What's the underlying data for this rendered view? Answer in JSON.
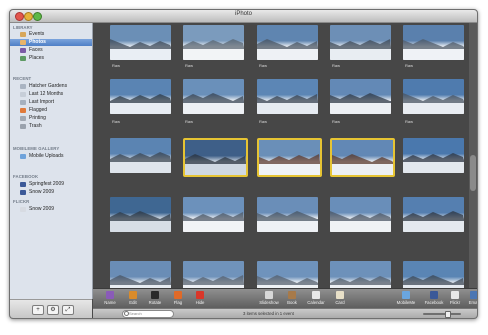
{
  "window": {
    "title": "iPhoto"
  },
  "sidebar": {
    "sections": [
      {
        "name": "library",
        "label": "LIBRARY",
        "items": [
          {
            "label": "Events",
            "icon": "events-icon",
            "color": "#d8a75a"
          },
          {
            "label": "Photos",
            "icon": "photos-icon",
            "color": "#e8b46a",
            "selected": true
          },
          {
            "label": "Faces",
            "icon": "faces-icon",
            "color": "#7b5aa6"
          },
          {
            "label": "Places",
            "icon": "places-icon",
            "color": "#5d9a63"
          }
        ]
      },
      {
        "name": "recent",
        "label": "RECENT",
        "items": [
          {
            "label": "Hatcher Gardens",
            "icon": "event-icon",
            "color": "#aab4c2"
          },
          {
            "label": "Last 12 Months",
            "icon": "calendar-icon",
            "color": "#c7ced8"
          },
          {
            "label": "Last Import",
            "icon": "import-icon",
            "color": "#a5b0be"
          },
          {
            "label": "Flagged",
            "icon": "flag-icon",
            "color": "#e07a3a"
          },
          {
            "label": "Printing",
            "icon": "printing-icon",
            "color": "#a2a9b3"
          },
          {
            "label": "Trash",
            "icon": "trash-icon",
            "color": "#9aa2ad"
          }
        ]
      },
      {
        "name": "mobile-gallery",
        "label": "MOBILEME GALLERY",
        "items": [
          {
            "label": "Mobile Uploads",
            "icon": "mobileme-icon",
            "color": "#6fa3db"
          }
        ]
      },
      {
        "name": "facebook",
        "label": "FACEBOOK",
        "items": [
          {
            "label": "Springfest 2009",
            "icon": "facebook-icon",
            "color": "#3b5998"
          },
          {
            "label": "Snow 2009",
            "icon": "facebook-icon",
            "color": "#3b5998"
          }
        ]
      },
      {
        "name": "flickr",
        "label": "FLICKR",
        "items": [
          {
            "label": "Snow 2009",
            "icon": "flickr-icon",
            "color": "#d7dbe2"
          }
        ]
      }
    ]
  },
  "grid": {
    "tag": "Raw",
    "rows": [
      {
        "tags": true,
        "photos": [
          {
            "sky": "#6b8fb6",
            "ground": "#e9eef4",
            "dark": "#3d4a58"
          },
          {
            "sky": "#7b9bbd",
            "ground": "#f2f4f6",
            "dark": "#5a6572"
          },
          {
            "sky": "#5f85b0",
            "ground": "#eef1f5",
            "dark": "#4b5563"
          },
          {
            "sky": "#6d8fb6",
            "ground": "#e8edf2",
            "dark": "#3f4a57"
          },
          {
            "sky": "#5a80ad",
            "ground": "#eff2f6",
            "dark": "#505b68"
          }
        ]
      },
      {
        "tags": true,
        "photos": [
          {
            "sky": "#5a84b3",
            "ground": "#e7ecf2",
            "dark": "#2e3945"
          },
          {
            "sky": "#6a90ba",
            "ground": "#eef1f5",
            "dark": "#3a4654"
          },
          {
            "sky": "#5c86b5",
            "ground": "#e6ebf1",
            "dark": "#384350"
          },
          {
            "sky": "#6389b6",
            "ground": "#edf0f4",
            "dark": "#2f3a47"
          },
          {
            "sky": "#4f7bae",
            "ground": "#e9edf2",
            "dark": "#4a5462"
          }
        ]
      },
      {
        "tags": false,
        "photos": [
          {
            "sky": "#5b84b2",
            "ground": "#dfe5ec",
            "dark": "#3b4551"
          },
          {
            "sky": "#3e5f88",
            "ground": "#cfd8e2",
            "dark": "#2b3440",
            "selected": true
          },
          {
            "sky": "#6a8fb8",
            "ground": "#f0f3f6",
            "dark": "#5c3a2e",
            "selected": true
          },
          {
            "sky": "#6288b5",
            "ground": "#edf0f4",
            "dark": "#5a392c",
            "selected": true
          },
          {
            "sky": "#4a78ad",
            "ground": "#e3e8ee",
            "dark": "#2c3441"
          }
        ]
      },
      {
        "tags": false,
        "photos": [
          {
            "sky": "#3f6792",
            "ground": "#d7dee6",
            "dark": "#2f3a46"
          },
          {
            "sky": "#6c91bb",
            "ground": "#f1f3f6",
            "dark": "#4d5866"
          },
          {
            "sky": "#6a8eb8",
            "ground": "#eef1f5",
            "dark": "#4a5563"
          },
          {
            "sky": "#698eb9",
            "ground": "#eff2f5",
            "dark": "#4b5664"
          },
          {
            "sky": "#557fb0",
            "ground": "#e4e9ef",
            "dark": "#2d3642"
          }
        ]
      },
      {
        "tags": false,
        "photos": [
          {
            "sky": "#6a8db6",
            "ground": "#e8edf2",
            "dark": "#4b5664"
          },
          {
            "sky": "#7093bb",
            "ground": "#eef1f5",
            "dark": "#56606d"
          },
          {
            "sky": "#6f93bc",
            "ground": "#eff2f5",
            "dark": "#56606d"
          },
          {
            "sky": "#6d91ba",
            "ground": "#edf0f4",
            "dark": "#525c69"
          },
          {
            "sky": "#5a85b4",
            "ground": "#e6ebf1",
            "dark": "#3e4856"
          }
        ]
      }
    ]
  },
  "toolbar": {
    "left": [
      {
        "label": "Name",
        "icon": "info-icon",
        "color": "#8a5bb8"
      },
      {
        "label": "Edit",
        "icon": "pencil-icon",
        "color": "#d98b2b"
      },
      {
        "label": "Rotate",
        "icon": "rotate-icon",
        "color": "#2a2a2a"
      },
      {
        "label": "Flag",
        "icon": "flag-icon",
        "color": "#e06a28"
      },
      {
        "label": "Hide",
        "icon": "hide-icon",
        "color": "#d9372a"
      }
    ],
    "center": [
      {
        "label": "Slideshow",
        "icon": "play-icon",
        "color": "#d8d8d8"
      },
      {
        "label": "Book",
        "icon": "book-icon",
        "color": "#a77a4a"
      },
      {
        "label": "Calendar",
        "icon": "calendar-icon",
        "color": "#e8e8e8"
      },
      {
        "label": "Card",
        "icon": "card-icon",
        "color": "#e8e0c8"
      }
    ],
    "right": [
      {
        "label": "MobileMe",
        "icon": "mobileme-icon",
        "color": "#6aa6e0"
      },
      {
        "label": "Facebook",
        "icon": "facebook-icon",
        "color": "#3b5998"
      },
      {
        "label": "Flickr",
        "icon": "flickr-icon",
        "color": "#e8e8e8"
      },
      {
        "label": "Email",
        "icon": "email-icon",
        "color": "#4b76b3"
      }
    ]
  },
  "sidebar_buttons": [
    {
      "label": "+",
      "name": "add-button"
    },
    {
      "label": "⚙",
      "name": "action-button"
    },
    {
      "label": "⤢",
      "name": "full-screen-button"
    }
  ],
  "statusbar": {
    "search_placeholder": "Search",
    "status": "3 items selected in 1 event"
  }
}
